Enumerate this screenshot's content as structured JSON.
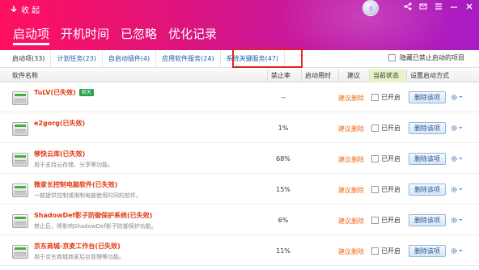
{
  "header": {
    "collapse_label": "收 起",
    "tabs": [
      {
        "label": "启动项",
        "active": true
      },
      {
        "label": "开机时间",
        "active": false
      },
      {
        "label": "已忽略",
        "active": false
      },
      {
        "label": "优化记录",
        "active": false
      }
    ],
    "controls": [
      "share-icon",
      "mail-icon",
      "menu-icon",
      "minimize-icon",
      "close-icon"
    ]
  },
  "subtabs": {
    "items": [
      {
        "label": "启动项(33)"
      },
      {
        "label": "计划任务(23)"
      },
      {
        "label": "自启动插件(4)"
      },
      {
        "label": "应用软件服务(24)"
      },
      {
        "label": "系统关键服务(47)",
        "selected": true
      }
    ],
    "hide_disabled_label": "隐藏已禁止启动的项目"
  },
  "table": {
    "columns": {
      "name": "软件名称",
      "ban_rate": "禁止率",
      "start_time": "启动用时",
      "suggest": "建议",
      "current": "当前状态",
      "setting": "设置启动方式"
    },
    "rows": [
      {
        "name": "TuLV(已失效)",
        "badge": "前天",
        "desc": "",
        "ban_rate": "--",
        "suggest": "建议删除",
        "status": "已开启",
        "action": "删除该项"
      },
      {
        "name": "e2gorg(已失效)",
        "badge": "",
        "desc": "",
        "ban_rate": "1%",
        "suggest": "建议删除",
        "status": "已开启",
        "action": "删除该项"
      },
      {
        "name": "够快云库(已失效)",
        "badge": "",
        "desc": "用于支持云存储、分享等功能。",
        "ban_rate": "68%",
        "suggest": "建议删除",
        "status": "已开启",
        "action": "删除该项"
      },
      {
        "name": "微家长控制电脑软件(已失效)",
        "badge": "",
        "desc": "一款提供控制或限制电脑使用时间的软件。",
        "ban_rate": "15%",
        "suggest": "建议删除",
        "status": "已开启",
        "action": "删除该项"
      },
      {
        "name": "ShadowDef影子防御保护系统(已失效)",
        "badge": "",
        "desc": "禁止后，将影响ShadowDef影子防御保护功能。",
        "ban_rate": "6%",
        "suggest": "建议删除",
        "status": "已开启",
        "action": "删除该项"
      },
      {
        "name": "京东商城-京麦工作台(已失效)",
        "badge": "",
        "desc": "用于京东商城商家后台管理等功能。",
        "ban_rate": "11%",
        "suggest": "建议删除",
        "status": "已开启",
        "action": "删除该项"
      }
    ]
  },
  "colors": {
    "header_start": "#ff1060",
    "header_end": "#a81cc4",
    "name_red": "#e03a12",
    "suggest_orange": "#f06a10",
    "link_blue": "#1a5ea8",
    "highlight_red": "#e22222"
  }
}
